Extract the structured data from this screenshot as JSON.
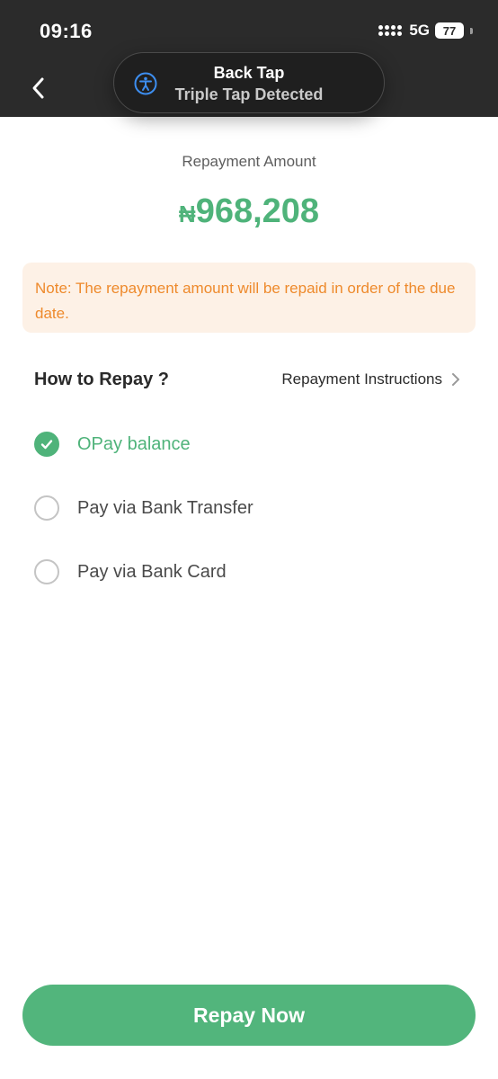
{
  "status_bar": {
    "time": "09:16",
    "network": "5G",
    "battery": "77"
  },
  "toast": {
    "icon": "accessibility-icon",
    "title": "Back Tap",
    "subtitle": "Triple Tap Detected"
  },
  "repayment": {
    "label": "Repayment Amount",
    "currency_symbol": "₦",
    "amount": "968,208"
  },
  "note": {
    "text": "Note: The repayment amount will be repaid in order of the due date."
  },
  "how_to_repay": {
    "title": "How to Repay ?",
    "instructions_link": "Repayment Instructions",
    "options": [
      {
        "label": "OPay balance",
        "selected": true
      },
      {
        "label": "Pay via Bank Transfer",
        "selected": false
      },
      {
        "label": "Pay via Bank Card",
        "selected": false
      }
    ]
  },
  "actions": {
    "repay_label": "Repay Now"
  },
  "colors": {
    "accent": "#4fb37a",
    "note_bg": "#fdf1e6",
    "note_text": "#ee8a2c",
    "header_bg": "#2b2b2b"
  }
}
